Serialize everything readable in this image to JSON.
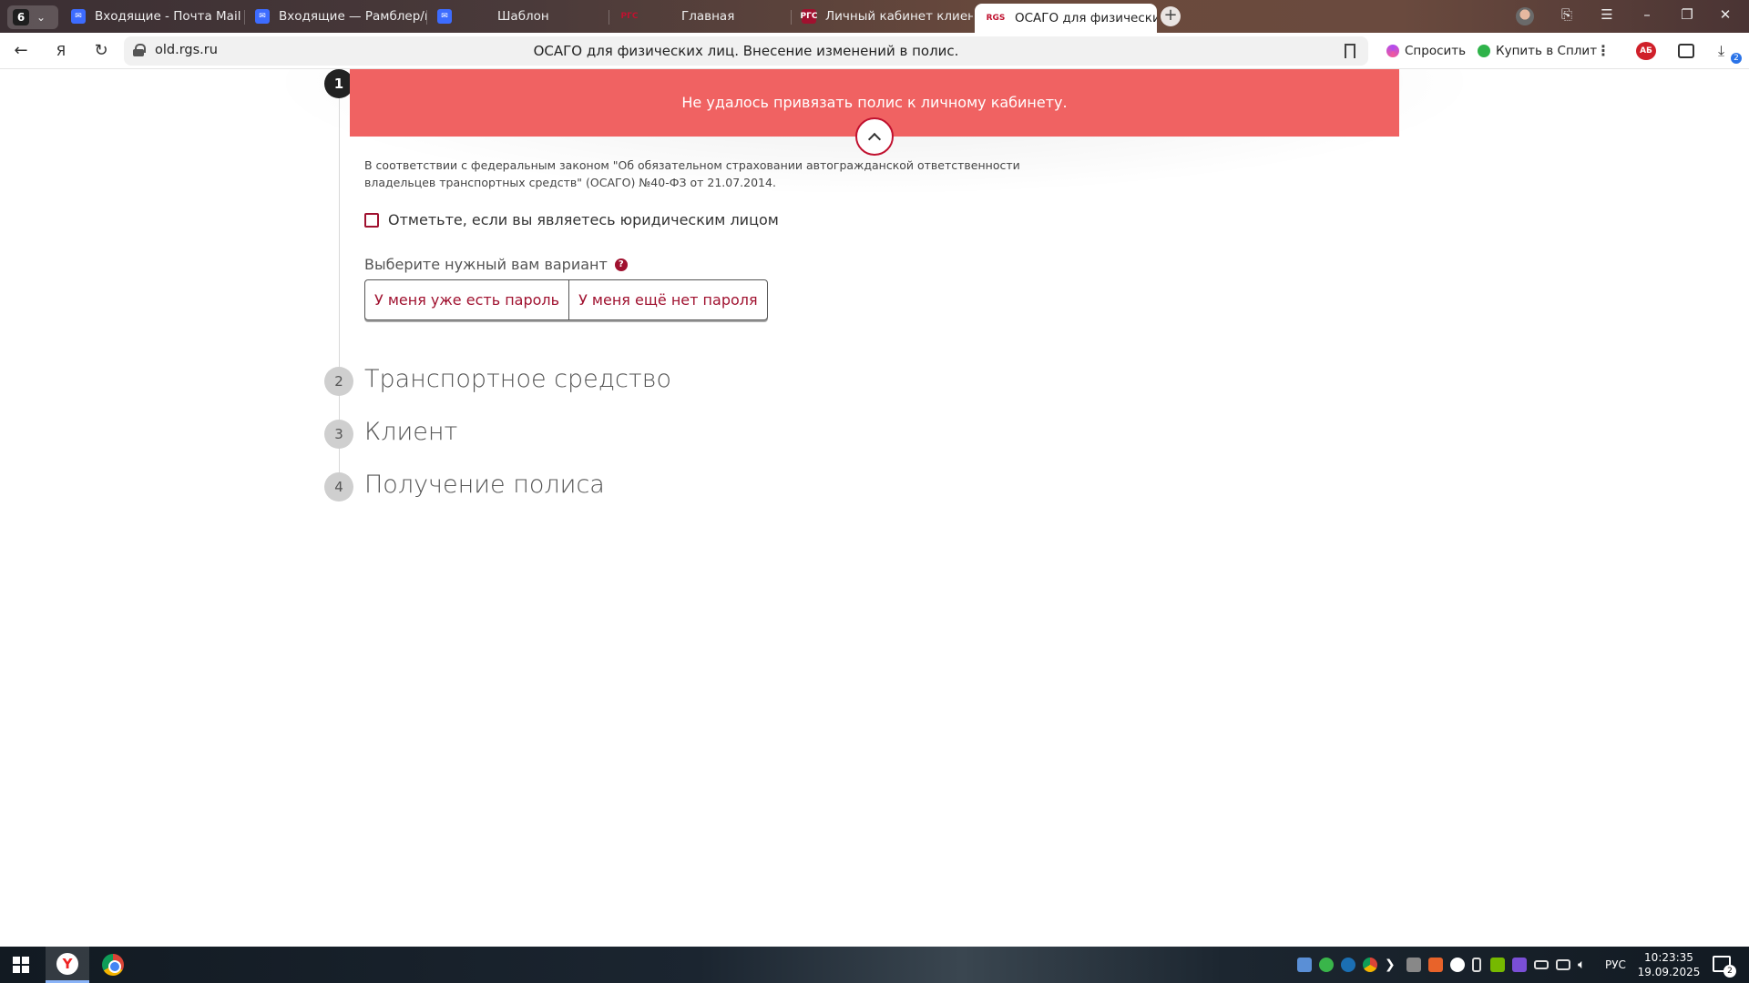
{
  "browser": {
    "tab_count": "6",
    "tabs": [
      {
        "label": "Входящие - Почта Mail",
        "icon": "mail-icon"
      },
      {
        "label": "Входящие — Рамблер/по",
        "icon": "mail-icon"
      },
      {
        "label": "Шаблон",
        "icon": "mail-icon"
      },
      {
        "label": "Главная",
        "icon": "rgs-logo-icon",
        "logo_text": "РГС"
      },
      {
        "label": "Личный кабинет клиента",
        "icon": "rgs-logo-icon",
        "logo_text": "РГС"
      },
      {
        "label": "ОСАГО для физически",
        "icon": "rgs-logo-icon",
        "logo_text": "RGS",
        "active": true
      }
    ],
    "address": {
      "domain": "old.rgs.ru",
      "page_title": "ОСАГО для физических лиц. Внесение изменений в полис."
    },
    "ask_label": "Спросить",
    "split_label": "Купить в Сплит",
    "extension_ab": "АБ",
    "downloads_badge": "2"
  },
  "banner": {
    "error_text": "Не удалось привязать полис к личному кабинету.",
    "color": "#f06262"
  },
  "form": {
    "legal_text": "В соответствии с федеральным законом \"Об обязательном страховании автогражданской ответственности владельцев транспортных средств\" (ОСАГО) №40-ФЗ от 21.07.2014.",
    "legal_entity_checkbox_label": "Отметьте, если вы являетесь юридическим лицом",
    "legal_entity_checked": false,
    "choose_label": "Выберите нужный вам вариант",
    "options": [
      "У меня уже есть пароль",
      "У меня ещё нет пароля"
    ],
    "accent_color": "#a0112f"
  },
  "steps": [
    {
      "number": "1",
      "title": "",
      "state": "active"
    },
    {
      "number": "2",
      "title": "Транспортное средство",
      "state": "inactive"
    },
    {
      "number": "3",
      "title": "Клиент",
      "state": "inactive"
    },
    {
      "number": "4",
      "title": "Получение полиса",
      "state": "inactive"
    }
  ],
  "taskbar": {
    "language": "РУС",
    "time": "10:23:35",
    "date": "19.09.2025",
    "notifications": "2"
  }
}
